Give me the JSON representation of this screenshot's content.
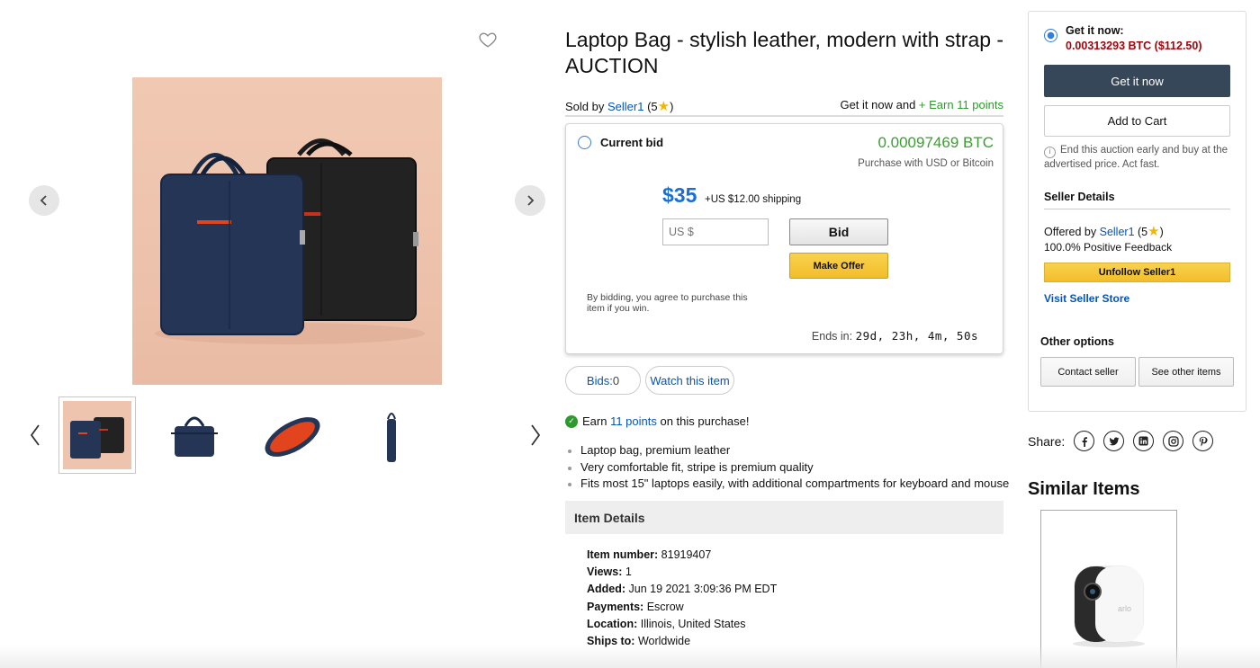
{
  "product": {
    "title": "Laptop Bag - stylish leather, modern with strap - AUCTION",
    "sold_by_prefix": "Sold by ",
    "seller": "Seller1",
    "rating_prefix": " (5",
    "rating_suffix": ")",
    "get_now_prefix": "Get it now and ",
    "earn_points_link": "+ Earn 11 points"
  },
  "bid": {
    "current_bid_label": "Current bid",
    "btc_price": "0.00097469 BTC",
    "purchase_note": "Purchase with USD or Bitcoin",
    "usd_price": "$35",
    "shipping": "+US $12.00 shipping",
    "input_placeholder": "US $",
    "bid_button": "Bid",
    "offer_button": "Make Offer",
    "agree_text": "By bidding, you agree to purchase this item if you win.",
    "ends_label": "Ends in: ",
    "ends_value": "29d, 23h, 4m, 50s"
  },
  "actions": {
    "bids_label": "Bids:",
    "bids_count": " 0",
    "watch": "Watch this item"
  },
  "earn": {
    "prefix": "Earn ",
    "points": "11 points",
    "suffix": " on this purchase!"
  },
  "features": [
    "Laptop bag, premium leather",
    "Very comfortable fit, stripe is premium quality",
    "Fits most 15\" laptops easily, with additional compartments for keyboard and mouse"
  ],
  "details": {
    "heading": "Item Details",
    "rows": [
      {
        "label": "Item number:",
        "value": " 81919407"
      },
      {
        "label": "Views:",
        "value": " 1"
      },
      {
        "label": "Added:",
        "value": " Jun 19 2021 3:09:36 PM EDT"
      },
      {
        "label": "Payments:",
        "value": " Escrow"
      },
      {
        "label": "Location:",
        "value": " Illinois, United States"
      },
      {
        "label": "Ships to:",
        "value": " Worldwide"
      }
    ]
  },
  "buy_panel": {
    "get_now_label": "Get it now:",
    "get_now_price": "0.00313293 BTC ($112.50)",
    "get_now_button": "Get it now",
    "add_to_cart": "Add to Cart",
    "info_note": "End this auction early and buy at the advertised price. Act fast.",
    "seller_details_title": "Seller Details",
    "offered_by_prefix": "Offered by ",
    "seller": "Seller1",
    "rating_prefix": " (5",
    "rating_suffix": ")",
    "feedback": "100.0% Positive Feedback",
    "unfollow": "Unfollow Seller1",
    "visit_store": "Visit Seller Store",
    "other_options": "Other options",
    "contact_seller": "Contact seller",
    "see_other_items": "See other items"
  },
  "share": {
    "label": "Share:",
    "icons": [
      "facebook-icon",
      "twitter-icon",
      "linkedin-icon",
      "instagram-icon",
      "pinterest-icon"
    ]
  },
  "similar": {
    "title": "Similar Items",
    "item_brand": "arlo"
  },
  "colors": {
    "link": "#0654ba",
    "green": "#2d9a2d",
    "btc_green": "#39a02f",
    "price_blue": "#1b6fd3",
    "price_red": "#a4040b",
    "dark_button": "#37475a",
    "yellow_button": "#f2bd2b"
  }
}
